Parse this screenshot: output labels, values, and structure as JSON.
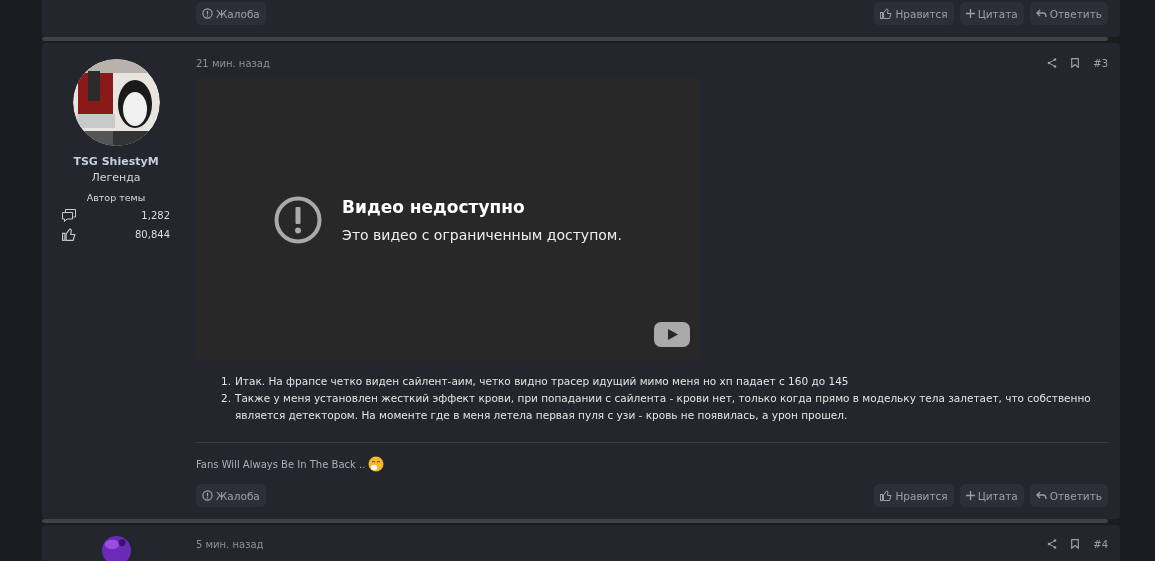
{
  "posts": [
    {
      "kind": "tail",
      "actions": [
        {
          "kind": "report",
          "label": "Жалоба"
        },
        {
          "kind": "like",
          "label": "Нравится"
        },
        {
          "kind": "quote",
          "label": "Цитата"
        },
        {
          "kind": "reply",
          "label": "Ответить"
        }
      ]
    },
    {
      "kind": "full",
      "author": {
        "name": "TSG ShiestyM",
        "rank": "Легенда",
        "badge": "Автор темы",
        "messages": "1,282",
        "reactions": "80,844"
      },
      "time": "21 мин. назад",
      "number": "#3",
      "video": {
        "title": "Видео недоступно",
        "message": "Это видео с ограниченным доступом."
      },
      "list": [
        {
          "marker": "1.",
          "text": "Итак. На фрапсе четко виден сайлент-аим, четко видно трасер идущий мимо меня но хп падает с 160 до 145"
        },
        {
          "marker": "2.",
          "text": "Также у меня установлен жесткий эффект крови, при попадании с сайлента - крови нет, только когда прямо в модельку тела залетает, что собственно является детектором. На моменте где в меня летела первая пуля с узи - кровь не появилась, а урон прошел."
        }
      ],
      "signature": "Fans Will Always Be In The Back ..",
      "actions": [
        {
          "kind": "report",
          "label": "Жалоба"
        },
        {
          "kind": "like",
          "label": "Нравится"
        },
        {
          "kind": "quote",
          "label": "Цитата"
        },
        {
          "kind": "reply",
          "label": "Ответить"
        }
      ]
    },
    {
      "kind": "head",
      "time": "5 мин. назад",
      "number": "#4"
    }
  ]
}
